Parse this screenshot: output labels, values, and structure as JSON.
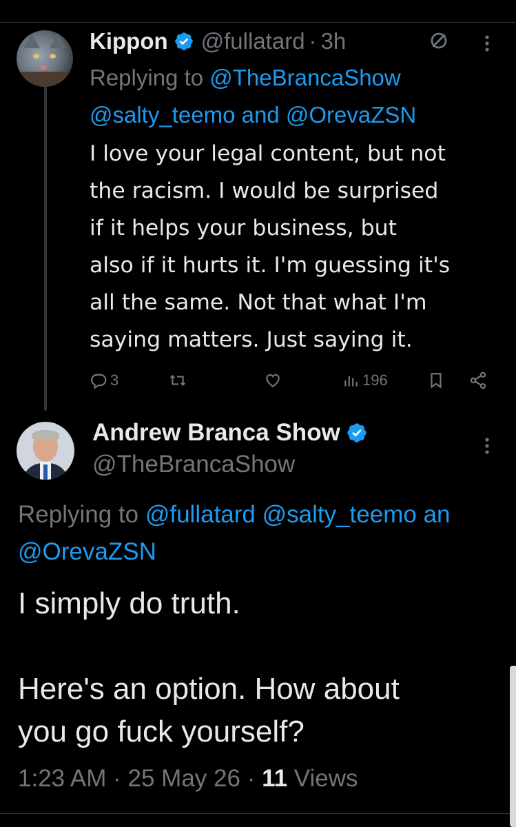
{
  "reply": {
    "name": "Kippon",
    "handle": "@fullatard",
    "separator": "·",
    "time": "3h",
    "replying_prefix": "Replying to ",
    "replying_mentions": [
      "@TheBrancaShow",
      "@salty_teemo"
    ],
    "replying_and": " and ",
    "replying_last": "@OrevaZSN",
    "text_lines": [
      "I love your legal content, but not",
      "the racism. I would be surprised",
      "if it helps your business, but",
      "also if it hurts it. I'm guessing it's",
      "all the same. Not that what I'm",
      "saying matters. Just saying it."
    ],
    "replies_count": "3",
    "views_count": "196"
  },
  "main": {
    "name": "Andrew Branca Show",
    "handle": "@TheBrancaShow",
    "replying_prefix": "Replying to ",
    "replying_line1_mentions": "@fullatard @salty_teemo",
    "replying_line1_tail": " an",
    "replying_line2": "@OrevaZSN",
    "text_line1": "I simply do truth.",
    "text_line2": "Here's an option. How about",
    "text_line3": "you go fuck yourself?",
    "time": "1:23 AM",
    "date": "25 May 26",
    "dot": " · ",
    "views_count": "11",
    "views_label": " Views"
  },
  "colors": {
    "background": "#000000",
    "text": "#e7e9ea",
    "secondary": "#71767b",
    "accent": "#1d9bf0"
  },
  "icons": [
    "verified-badge-icon",
    "no-sign-icon",
    "more-icon",
    "reply-icon",
    "repost-icon",
    "like-icon",
    "views-icon",
    "bookmark-icon",
    "share-icon"
  ]
}
